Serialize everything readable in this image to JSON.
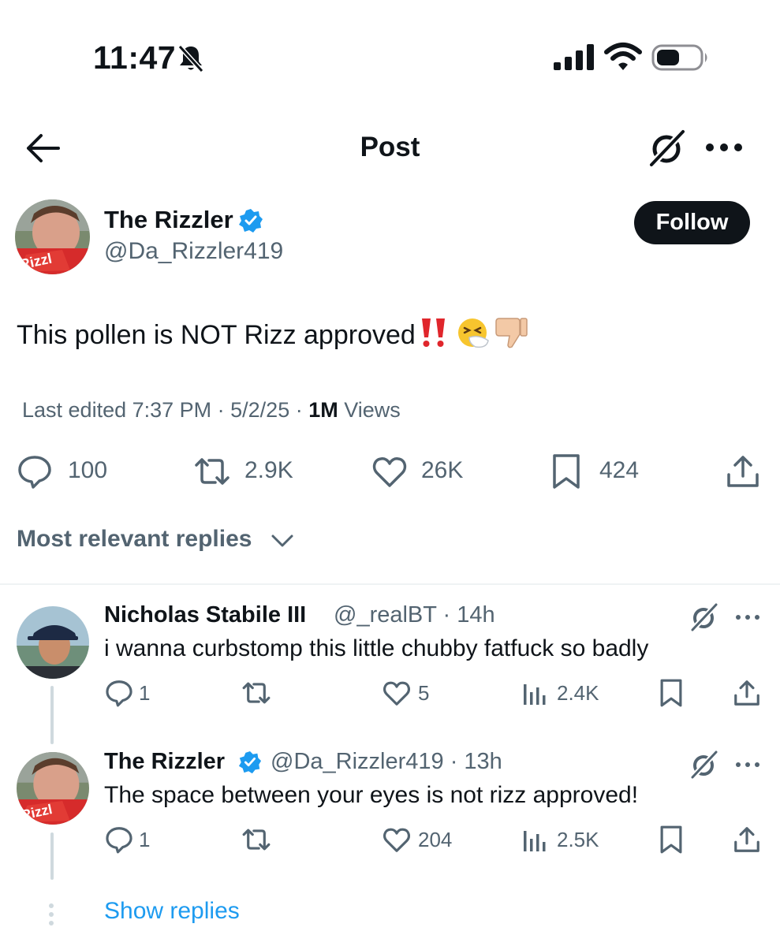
{
  "status_bar": {
    "time": "11:47",
    "icons": [
      "bell-slash-icon",
      "signal-icon",
      "wifi-icon",
      "battery-icon"
    ]
  },
  "nav": {
    "title": "Post",
    "icons": [
      "back-arrow-icon",
      "grok-icon",
      "more-icon"
    ]
  },
  "post": {
    "author_name": "The Rizzler",
    "author_handle": "@Da_Rizzler419",
    "follow_label": "Follow",
    "text": "This pollen is NOT Rizz approved",
    "emojis": [
      "double-exclamation-icon",
      "sneezing-face-icon",
      "thumbs-down-icon"
    ],
    "meta_prefix": "Last edited 7:37 PM · 5/2/25 · ",
    "views_count": "1M",
    "views_label": " Views",
    "actions": {
      "replies": "100",
      "reposts": "2.9K",
      "likes": "26K",
      "bookmarks": "424"
    }
  },
  "sort_label": "Most relevant replies",
  "replies": [
    {
      "name": "Nicholas Stabile III",
      "handle": "@_realBT · 14h",
      "text": "i wanna curbstomp this little chubby fatfuck so badly",
      "replies": "1",
      "reposts": "",
      "likes": "5",
      "views": "2.4K"
    },
    {
      "name": "The Rizzler",
      "handle": "@Da_Rizzler419 · 13h",
      "text": "The space between your eyes is not rizz approved!",
      "replies": "1",
      "reposts": "",
      "likes": "204",
      "views": "2.5K"
    }
  ],
  "show_replies_label": "Show replies",
  "colors": {
    "text": "#0f1419",
    "secondary": "#536471",
    "link": "#1d9bf0",
    "verified": "#1d9bf0",
    "divider": "#eff3f4"
  }
}
